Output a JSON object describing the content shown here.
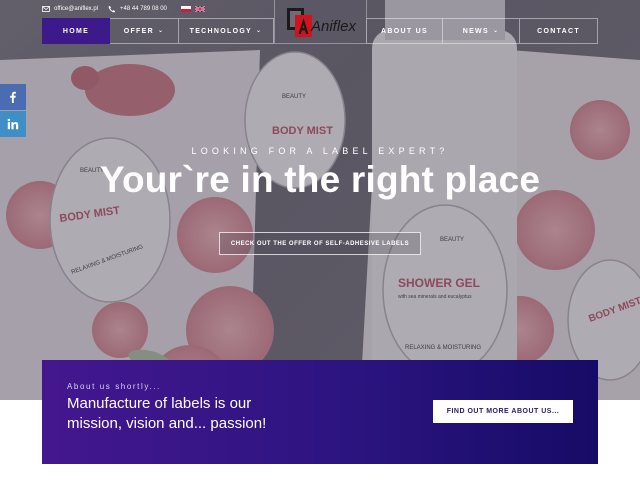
{
  "topbar": {
    "email": "office@aniflex.pl",
    "phone": "+48 44 789 08 00",
    "email_icon": "envelope-icon",
    "phone_icon": "phone-icon",
    "languages": [
      "pl",
      "en"
    ]
  },
  "logo": {
    "text": "Aniflex"
  },
  "nav": {
    "items": [
      {
        "label": "HOME",
        "active": true
      },
      {
        "label": "OFFER",
        "dropdown": true
      },
      {
        "label": "TECHNOLOGY",
        "dropdown": true
      },
      {
        "label": "ABOUT US"
      },
      {
        "label": "NEWS",
        "dropdown": true
      },
      {
        "label": "CONTACT"
      }
    ]
  },
  "social": {
    "facebook_icon": "facebook-icon",
    "linkedin_icon": "linkedin-icon"
  },
  "hero": {
    "eyebrow": "LOOKING FOR A LABEL EXPERT?",
    "headline": "Your`re in the right place",
    "cta_label": "CHECK OUT THE OFFER OF SELF-ADHESIVE LABELS",
    "product_labels": {
      "beauty": "BEAUTY",
      "body_mist": "BODY MIST",
      "shower_gel": "SHOWER GEL",
      "shower_gel_sub": "with sea minerals and eucalyptus",
      "relaxing": "RELAXING & MOISTURING"
    }
  },
  "about": {
    "eyebrow": "About us shortly...",
    "text": "Manufacture of labels is our mission, vision and... passion!",
    "button_label": "FIND OUT MORE ABOUT US..."
  },
  "colors": {
    "nav_active": "#3d1a8c",
    "about_start": "#44178f",
    "about_end": "#160b66",
    "facebook": "#4b6cb0",
    "linkedin": "#3f8fc6"
  }
}
